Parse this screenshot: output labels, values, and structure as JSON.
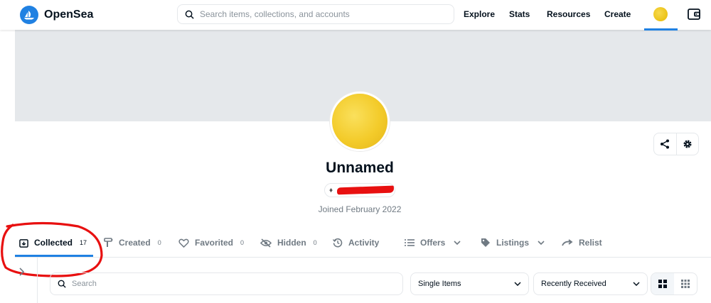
{
  "header": {
    "brand": "OpenSea",
    "search_placeholder": "Search items, collections, and accounts",
    "nav": [
      "Explore",
      "Stats",
      "Resources",
      "Create"
    ]
  },
  "profile": {
    "name": "Unnamed",
    "joined": "Joined February 2022"
  },
  "tabs": [
    {
      "label": "Collected",
      "count": "17",
      "icon": "collected-icon",
      "active": true
    },
    {
      "label": "Created",
      "count": "0",
      "icon": "paint-brush-icon"
    },
    {
      "label": "Favorited",
      "count": "0",
      "icon": "heart-icon"
    },
    {
      "label": "Hidden",
      "count": "0",
      "icon": "eye-off-icon"
    },
    {
      "label": "Activity",
      "icon": "history-icon"
    },
    {
      "label": "Offers",
      "icon": "list-icon",
      "dropdown": true
    },
    {
      "label": "Listings",
      "icon": "tag-icon",
      "dropdown": true
    },
    {
      "label": "Relist",
      "icon": "redo-icon"
    }
  ],
  "filters": {
    "search_placeholder": "Search",
    "item_type": "Single Items",
    "sort": "Recently Received"
  },
  "colors": {
    "brand_blue": "#2081e2",
    "banner": "#e5e8eb",
    "annotation_red": "#e81010"
  }
}
